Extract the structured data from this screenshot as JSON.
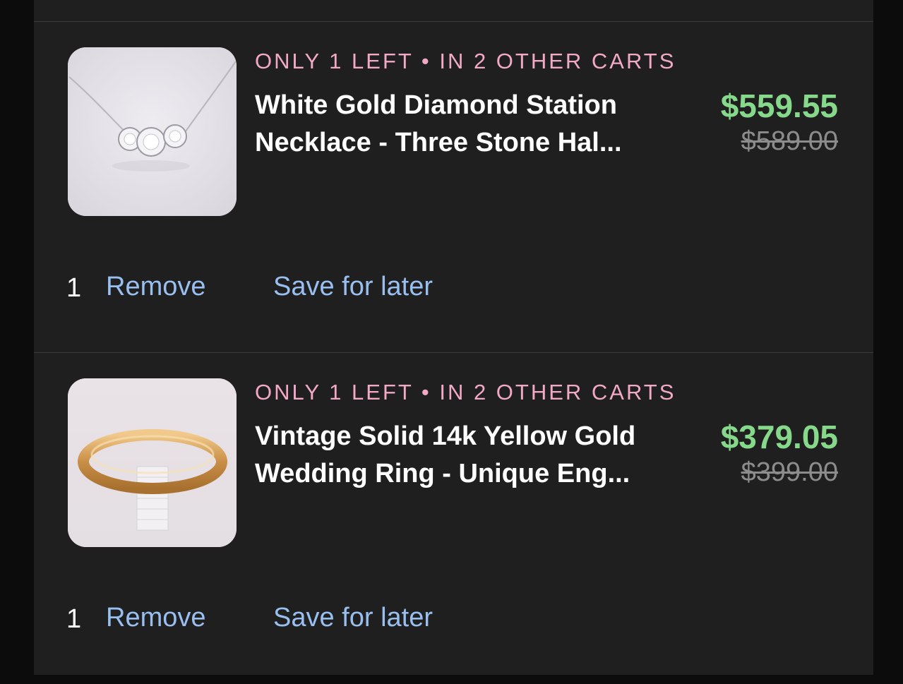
{
  "cart_items": [
    {
      "stock_badge": "ONLY 1 LEFT • IN 2 OTHER CARTS",
      "title_line1": "White Gold Diamond Station",
      "title_line2": "Necklace - Three Stone Hal...",
      "price_now": "$559.55",
      "price_was": "$589.00",
      "quantity": "1",
      "remove_label": "Remove",
      "save_label": "Save for later",
      "image_icon": "necklace-photo"
    },
    {
      "stock_badge": "ONLY 1 LEFT • IN 2 OTHER CARTS",
      "title_line1": "Vintage Solid 14k Yellow Gold",
      "title_line2": "Wedding Ring - Unique Eng...",
      "price_now": "$379.05",
      "price_was": "$399.00",
      "quantity": "1",
      "remove_label": "Remove",
      "save_label": "Save for later",
      "image_icon": "ring-photo"
    }
  ],
  "colors": {
    "background": "#1f1f1f",
    "badge": "#f2a9c6",
    "sale_price": "#86d98a",
    "link": "#99bff0",
    "original_price": "#8c8c8c"
  }
}
